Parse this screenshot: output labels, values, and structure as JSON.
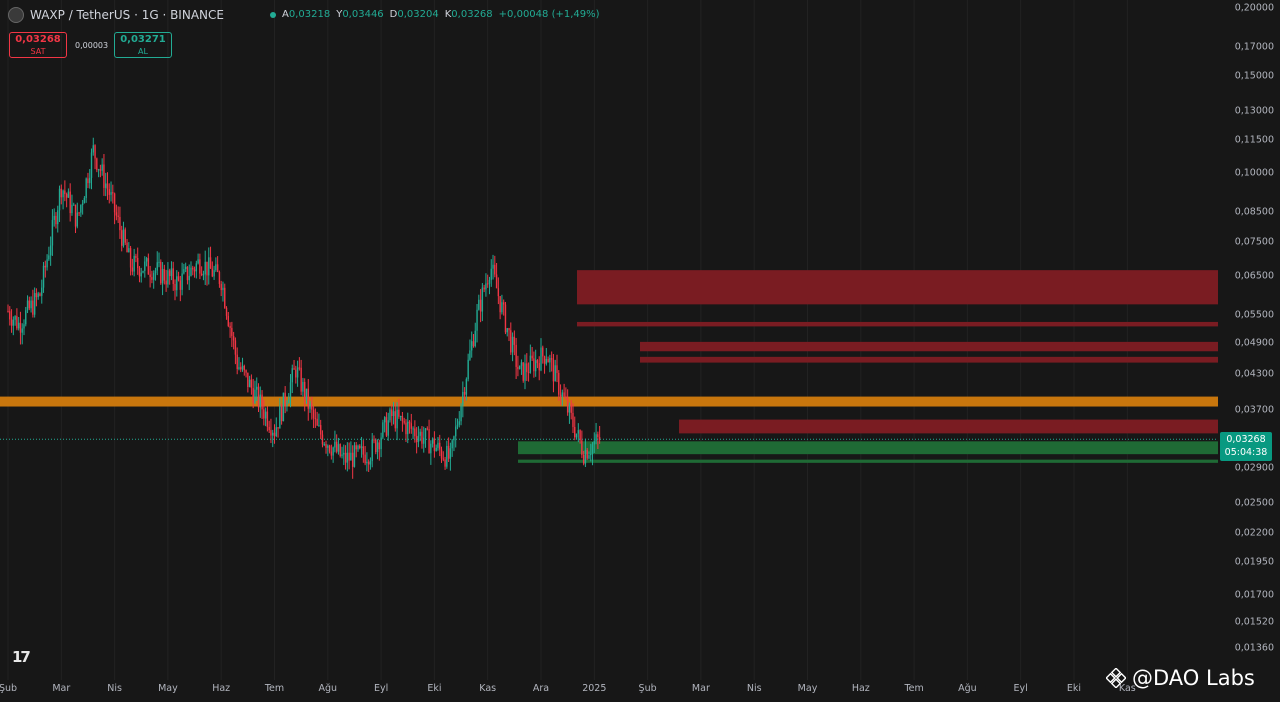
{
  "header": {
    "title": "WAXP / TetherUS · 1G · BINANCE",
    "ohlc": [
      {
        "label": "A",
        "value": "0,03218"
      },
      {
        "label": "Y",
        "value": "0,03446"
      },
      {
        "label": "D",
        "value": "0,03204"
      },
      {
        "label": "K",
        "value": "0,03268"
      }
    ],
    "change": "+0,00048 (+1,49%)"
  },
  "trade": {
    "sell_price": "0,03268",
    "sell_label": "SAT",
    "spread": "0,00003",
    "buy_price": "0,03271",
    "buy_label": "AL"
  },
  "price_axis": {
    "ticks": [
      "0,20000",
      "0,17000",
      "0,15000",
      "0,13000",
      "0,11500",
      "0,10000",
      "0,08500",
      "0,07500",
      "0,06500",
      "0,05500",
      "0,04900",
      "0,04300",
      "0,03700",
      "0,02900",
      "0,02500",
      "0,02200",
      "0,01950",
      "0,01700",
      "0,01520",
      "0,01360"
    ],
    "current_price": "0,03268",
    "countdown": "05:04:38"
  },
  "time_axis": [
    "Şub",
    "Mar",
    "Nis",
    "May",
    "Haz",
    "Tem",
    "Ağu",
    "Eyl",
    "Eki",
    "Kas",
    "Ara",
    "2025",
    "Şub",
    "Mar",
    "Nis",
    "May",
    "Haz",
    "Tem",
    "Ağu",
    "Eyl",
    "Eki",
    "Kas"
  ],
  "watermark": "@DAO Labs",
  "colors": {
    "background": "#171717",
    "up": "#22ab94",
    "down": "#f23645",
    "resistance_zone": "#7a1c22",
    "support_zone": "#1f6a35",
    "key_level": "#c8760d"
  },
  "zones": {
    "key_level": [
      0.0375,
      0.0391
    ],
    "support": [
      {
        "low": 0.0307,
        "high": 0.0324
      },
      {
        "low": 0.0296,
        "high": 0.03
      }
    ],
    "resistance": [
      {
        "low": 0.0576,
        "high": 0.0665
      },
      {
        "low": 0.0525,
        "high": 0.0535
      },
      {
        "low": 0.0473,
        "high": 0.0492
      },
      {
        "low": 0.0451,
        "high": 0.0462
      },
      {
        "low": 0.0335,
        "high": 0.0355
      }
    ]
  },
  "chart_data": {
    "type": "candlestick",
    "scale": "log",
    "ylim": [
      0.0136,
      0.2
    ],
    "x_start_month": "Şub",
    "trend_anchors": [
      {
        "m": 0.0,
        "p": 0.056
      },
      {
        "m": 0.2,
        "p": 0.053
      },
      {
        "m": 0.6,
        "p": 0.06
      },
      {
        "m": 1.0,
        "p": 0.095
      },
      {
        "m": 1.3,
        "p": 0.082
      },
      {
        "m": 1.6,
        "p": 0.11
      },
      {
        "m": 1.9,
        "p": 0.092
      },
      {
        "m": 2.3,
        "p": 0.068
      },
      {
        "m": 2.7,
        "p": 0.067
      },
      {
        "m": 3.2,
        "p": 0.063
      },
      {
        "m": 3.6,
        "p": 0.069
      },
      {
        "m": 4.0,
        "p": 0.064
      },
      {
        "m": 4.3,
        "p": 0.045
      },
      {
        "m": 4.6,
        "p": 0.04
      },
      {
        "m": 5.0,
        "p": 0.034
      },
      {
        "m": 5.4,
        "p": 0.044
      },
      {
        "m": 5.8,
        "p": 0.034
      },
      {
        "m": 6.3,
        "p": 0.03
      },
      {
        "m": 6.8,
        "p": 0.031
      },
      {
        "m": 7.2,
        "p": 0.036
      },
      {
        "m": 7.8,
        "p": 0.033
      },
      {
        "m": 8.3,
        "p": 0.03
      },
      {
        "m": 8.8,
        "p": 0.055
      },
      {
        "m": 9.05,
        "p": 0.068
      },
      {
        "m": 9.3,
        "p": 0.055
      },
      {
        "m": 9.6,
        "p": 0.043
      },
      {
        "m": 10.1,
        "p": 0.047
      },
      {
        "m": 10.5,
        "p": 0.037
      },
      {
        "m": 10.8,
        "p": 0.031
      },
      {
        "m": 11.1,
        "p": 0.0327
      }
    ]
  }
}
